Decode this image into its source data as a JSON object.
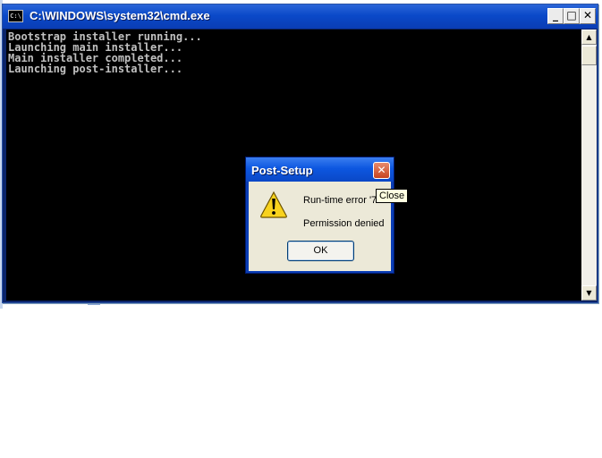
{
  "cmd_window": {
    "title": "C:\\WINDOWS\\system32\\cmd.exe",
    "icon_text": "C:\\",
    "buttons": {
      "minimize": "_",
      "maximize": "□",
      "close": "✕"
    },
    "console_lines": [
      "Bootstrap installer running...",
      "Launching main installer...",
      "Main installer completed...",
      "Launching post-installer..."
    ],
    "scroll_up": "▲",
    "scroll_down": "▼"
  },
  "dialog": {
    "title": "Post-Setup",
    "close_glyph": "✕",
    "icon": "warning-icon",
    "message_line1": "Run-time error '7",
    "message_line2": "Permission denied",
    "ok_label": "OK",
    "tooltip": "Close"
  },
  "colors": {
    "titlebar": "#0a49c9",
    "console_bg": "#000000",
    "console_text": "#c0c0c0",
    "dialog_body": "#ece9d8",
    "close_button": "#c64420",
    "tooltip_bg": "#ffffe1"
  }
}
